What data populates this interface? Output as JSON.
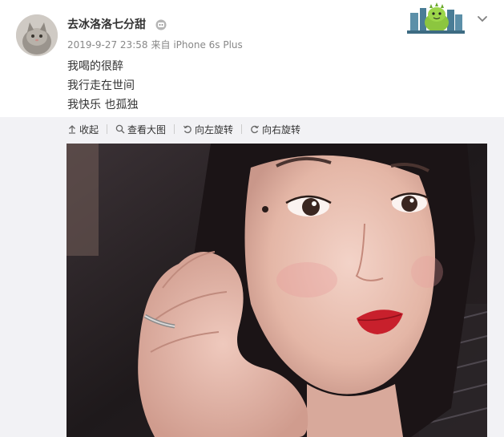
{
  "post": {
    "username": "去冰洛洛七分甜",
    "timestamp": "2019-9-27 23:58",
    "source": "来自 iPhone 6s Plus",
    "lines": [
      "我喝的很醉",
      "我行走在世间",
      "我快乐 也孤独"
    ]
  },
  "toolbar": {
    "collapse": "收起",
    "view_large": "查看大图",
    "rotate_left": "向左旋转",
    "rotate_right": "向右旋转"
  },
  "icons": {
    "collapse": "arrow-up-icon",
    "view_large": "search-icon",
    "rotate_left": "rotate-left-icon",
    "rotate_right": "rotate-right-icon",
    "badge": "member-badge-icon",
    "dropdown": "chevron-down-icon",
    "corner_card": "dinosaur-sticker-icon"
  }
}
